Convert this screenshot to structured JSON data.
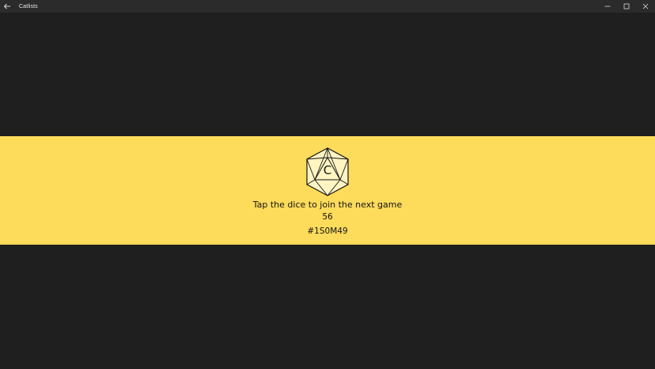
{
  "window": {
    "title": "Catlists",
    "back_icon": "back-arrow-icon",
    "controls": [
      "minimize-icon",
      "maximize-icon",
      "close-icon"
    ]
  },
  "banner": {
    "background": "#fddb5b",
    "dice_letter": "C",
    "prompt": "Tap the dice to join the next game",
    "count": "56",
    "code": "#1S0M49"
  },
  "colors": {
    "app_background": "#1f1f1f",
    "titlebar_background": "#2b2b2b"
  }
}
